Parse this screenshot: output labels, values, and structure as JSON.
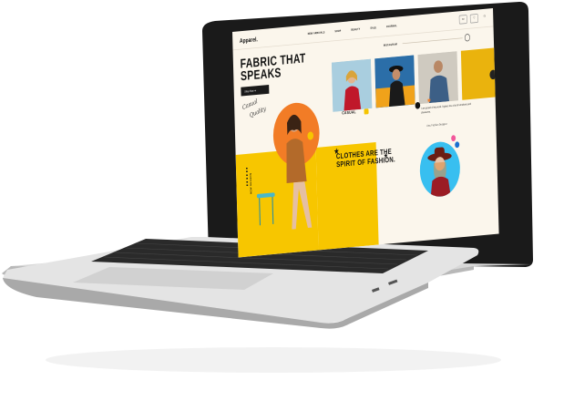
{
  "site": {
    "logo": "Apparel.",
    "nav": [
      "NEW ARRIVALS",
      "SHOP",
      "BEAUTY",
      "SALE",
      "JOURNAL"
    ],
    "hero_title": "FABRIC THAT SPEAKS",
    "shop_button": "Shop Now",
    "instagram_label": "INSTAGRAM",
    "card_label": "CASUAL",
    "script_1": "Casual",
    "script_2": "Quality",
    "side_text": "NEW SEASON",
    "quote": "CLOTHES ARE THE SPIRIT OF FASHION.",
    "testimonial": "I am proud of my work. It gives me a lot of emotions and pleasures.",
    "testimonial_author": "Ana, Fashion Designer"
  },
  "colors": {
    "cream": "#fbf6ec",
    "orange": "#f27c26",
    "yellow": "#f7c600",
    "blue": "#38bff0",
    "pink": "#f2579b",
    "dark": "#1a1a1a"
  }
}
